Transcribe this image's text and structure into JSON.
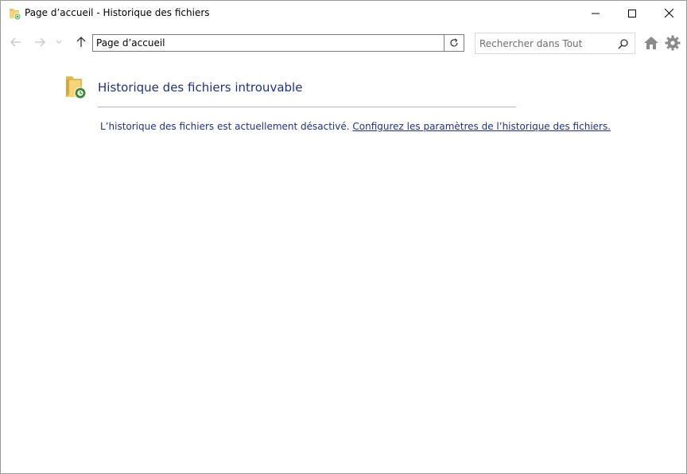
{
  "window": {
    "title": "Page d’accueil - Historique des fichiers"
  },
  "nav": {
    "address": "Page d’accueil",
    "search_placeholder": "Rechercher dans Tout"
  },
  "main": {
    "heading": "Historique des fichiers introuvable",
    "message": "L’historique des fichiers est actuellement désactivé.",
    "link": "Configurez les paramètres de l’historique des fichiers."
  },
  "colors": {
    "heading": "#1e3287",
    "link": "#1e3287",
    "divider": "#b5b5b5"
  }
}
